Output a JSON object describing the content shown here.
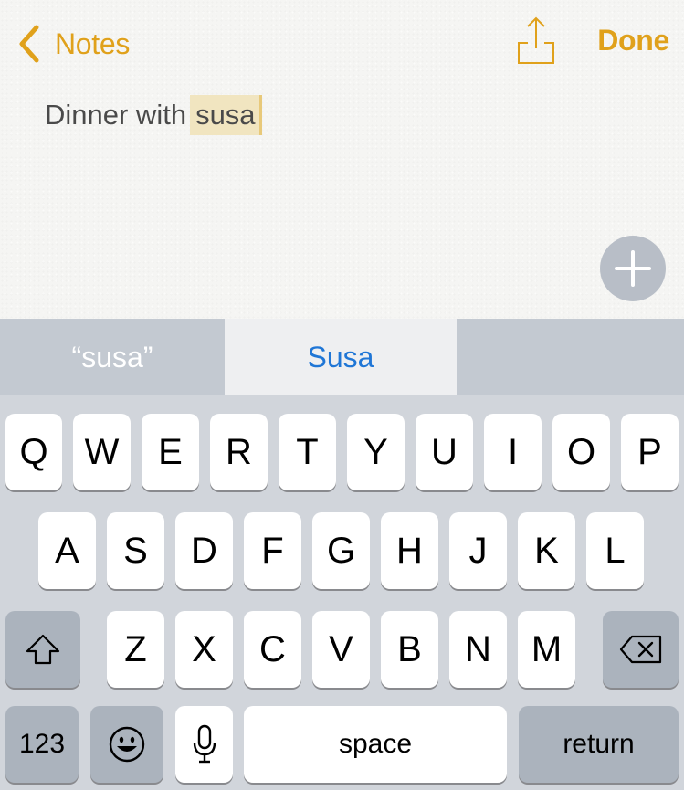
{
  "nav": {
    "back_label": "Notes",
    "done_label": "Done",
    "accent_color": "#e0a11b"
  },
  "note": {
    "text_prefix": "Dinner with",
    "text_selected": "susa"
  },
  "suggestions": [
    {
      "label": "“susa”"
    },
    {
      "label": "Susa"
    },
    {
      "label": ""
    }
  ],
  "keyboard": {
    "row1": [
      "Q",
      "W",
      "E",
      "R",
      "T",
      "Y",
      "U",
      "I",
      "O",
      "P"
    ],
    "row2": [
      "A",
      "S",
      "D",
      "F",
      "G",
      "H",
      "J",
      "K",
      "L"
    ],
    "row3": [
      "Z",
      "X",
      "C",
      "V",
      "B",
      "N",
      "M"
    ],
    "numbers_label": "123",
    "space_label": "space",
    "return_label": "return",
    "shift_icon": "shift-icon",
    "delete_icon": "delete-icon",
    "emoji_icon": "emoji-icon",
    "mic_icon": "microphone-icon"
  }
}
